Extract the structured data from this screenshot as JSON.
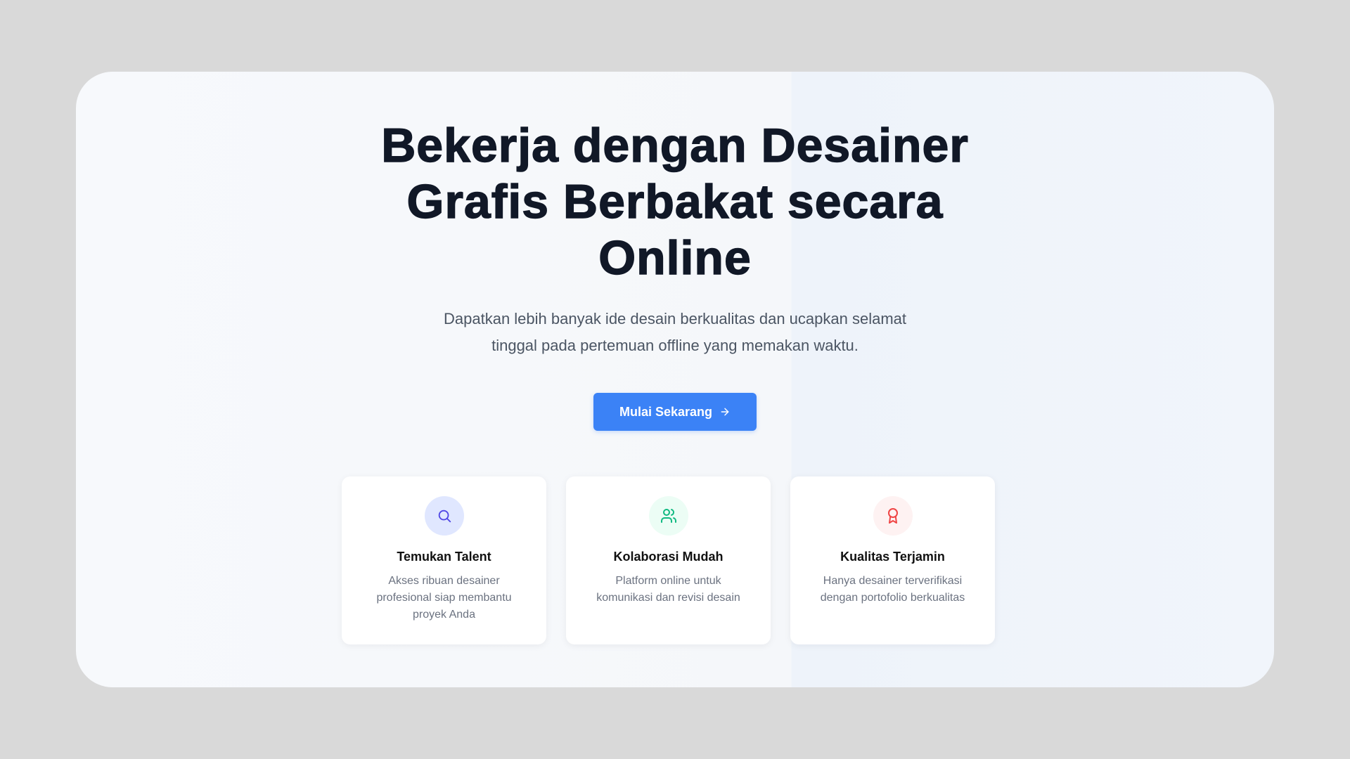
{
  "hero": {
    "headline": "Bekerja dengan Desainer Grafis Berbakat secara Online",
    "subtitle": "Dapatkan lebih banyak ide desain berkualitas dan ucapkan selamat tinggal pada pertemuan offline yang memakan waktu.",
    "cta_label": "Mulai Sekarang",
    "cta_icon": "arrow-right-icon",
    "cta_color": "#3b82f6"
  },
  "features": [
    {
      "icon": "search-icon",
      "icon_color": "#4f46e5",
      "icon_bg": "#e0e7ff",
      "title": "Temukan Talent",
      "description": "Akses ribuan desainer profesional siap membantu proyek Anda"
    },
    {
      "icon": "users-icon",
      "icon_color": "#10b981",
      "icon_bg": "#ecfdf5",
      "title": "Kolaborasi Mudah",
      "description": "Platform online untuk komunikasi dan revisi desain"
    },
    {
      "icon": "award-icon",
      "icon_color": "#ef4444",
      "icon_bg": "#fef2f2",
      "title": "Kualitas Terjamin",
      "description": "Hanya desainer terverifikasi dengan portofolio berkualitas"
    }
  ]
}
